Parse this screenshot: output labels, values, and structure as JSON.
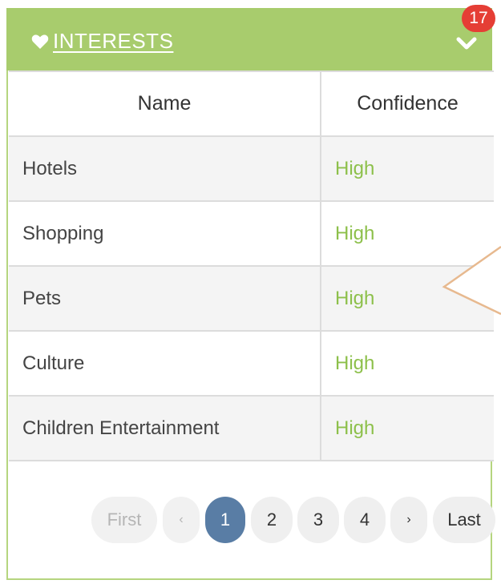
{
  "panel": {
    "title": "INTERESTS",
    "badge_count": "17",
    "colors": {
      "header": "#a8cc6d",
      "badge": "#e53e35",
      "confidence_text": "#8dc04b",
      "pager_active": "#597da5"
    }
  },
  "table": {
    "columns": [
      "Name",
      "Confidence"
    ],
    "rows": [
      {
        "name": "Hotels",
        "confidence": "High"
      },
      {
        "name": "Shopping",
        "confidence": "High"
      },
      {
        "name": "Pets",
        "confidence": "High"
      },
      {
        "name": "Culture",
        "confidence": "High"
      },
      {
        "name": "Children Entertainment",
        "confidence": "High"
      }
    ]
  },
  "pagination": {
    "first": "First",
    "prev": "‹",
    "pages": [
      "1",
      "2",
      "3",
      "4"
    ],
    "current_page": "1",
    "next": "›",
    "last": "Last"
  }
}
